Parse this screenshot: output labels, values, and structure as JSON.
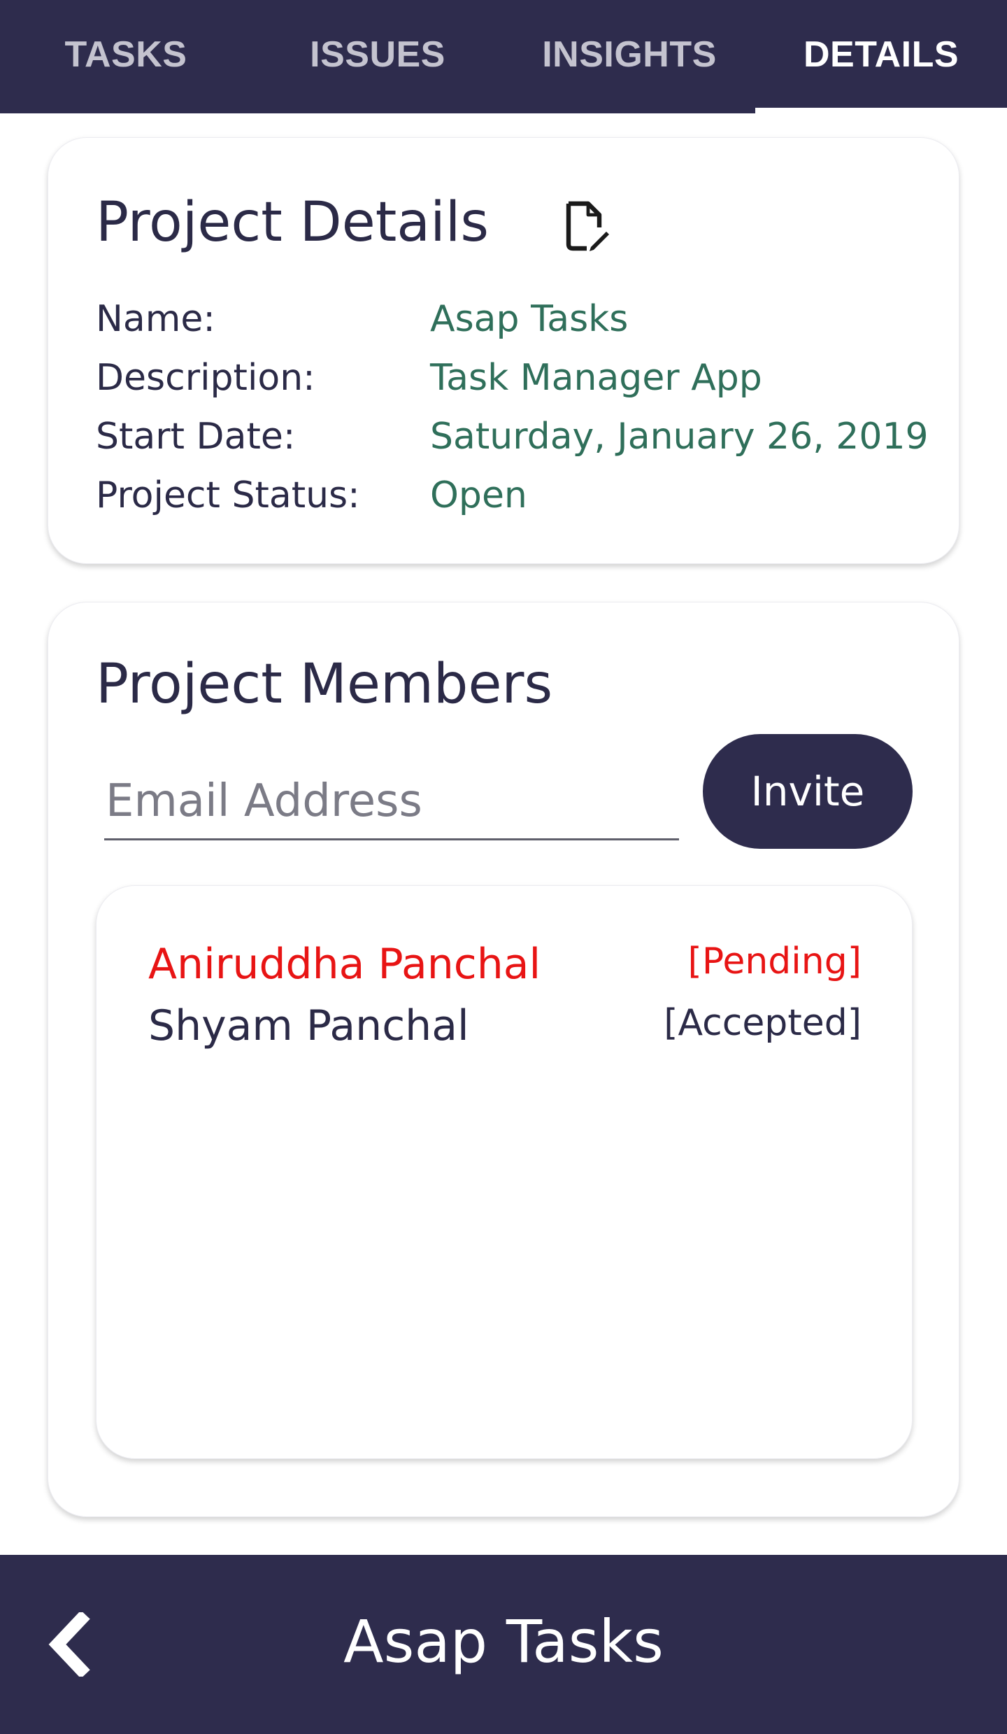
{
  "tabs": [
    {
      "label": "TASKS"
    },
    {
      "label": "ISSUES"
    },
    {
      "label": "INSIGHTS"
    },
    {
      "label": "DETAILS"
    }
  ],
  "active_tab": "DETAILS",
  "project_details": {
    "title": "Project Details",
    "edit_icon": "edit-document-icon",
    "rows": [
      {
        "label": "Name:",
        "value": "Asap Tasks"
      },
      {
        "label": "Description:",
        "value": "Task Manager App"
      },
      {
        "label": "Start Date:",
        "value": "Saturday, January 26, 2019"
      },
      {
        "label": "Project Status:",
        "value": "Open"
      }
    ]
  },
  "project_members": {
    "title": "Project Members",
    "email_placeholder": "Email Address",
    "email_value": "",
    "invite_label": "Invite",
    "members": [
      {
        "name": "Aniruddha Panchal",
        "status": "[Pending]"
      },
      {
        "name": "Shyam Panchal",
        "status": "[Accepted]"
      }
    ]
  },
  "bottom_bar": {
    "title": "Asap Tasks",
    "back_icon": "chevron-left-icon"
  },
  "colors": {
    "primary": "#2e2c4d",
    "value_text": "#2f6f5a",
    "pending": "#e81414",
    "text": "#2b2a47"
  }
}
